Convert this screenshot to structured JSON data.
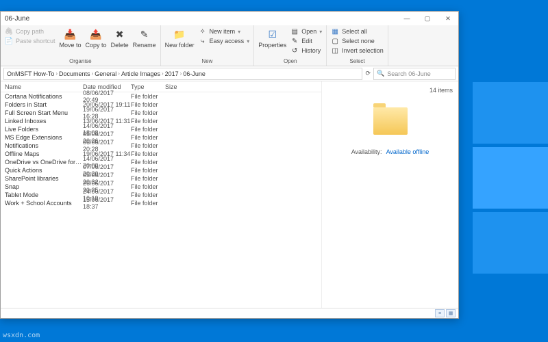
{
  "window": {
    "title": "06-June"
  },
  "ribbon": {
    "organise": {
      "copy_path": "Copy path",
      "paste_shortcut": "Paste shortcut",
      "move_to": "Move to",
      "copy_to": "Copy to",
      "delete": "Delete",
      "rename": "Rename",
      "group": "Organise"
    },
    "new": {
      "new_folder": "New folder",
      "new_item": "New item",
      "easy_access": "Easy access",
      "group": "New"
    },
    "open": {
      "properties": "Properties",
      "open": "Open",
      "edit": "Edit",
      "history": "History",
      "group": "Open"
    },
    "select": {
      "select_all": "Select all",
      "select_none": "Select none",
      "invert": "Invert selection",
      "group": "Select"
    }
  },
  "breadcrumbs": [
    "OnMSFT How-To",
    "Documents",
    "General",
    "Article Images",
    "2017",
    "06-June"
  ],
  "columns": {
    "name": "Name",
    "date": "Date modified",
    "type": "Type",
    "size": "Size"
  },
  "rows": [
    {
      "name": "Cortana Notifications",
      "date": "08/06/2017 20:49",
      "type": "File folder"
    },
    {
      "name": "Folders in Start",
      "date": "20/06/2017 19:11",
      "type": "File folder"
    },
    {
      "name": "Full Screen Start Menu",
      "date": "19/06/2017 16:28",
      "type": "File folder"
    },
    {
      "name": "Linked Inboxes",
      "date": "13/06/2017 11:31",
      "type": "File folder"
    },
    {
      "name": "Live Folders",
      "date": "14/06/2017 18:08",
      "type": "File folder"
    },
    {
      "name": "MS Edge Extensions",
      "date": "05/06/2017 20:26",
      "type": "File folder"
    },
    {
      "name": "Notifications",
      "date": "06/06/2017 20:28",
      "type": "File folder"
    },
    {
      "name": "Offline Maps",
      "date": "19/06/2017 11:34",
      "type": "File folder"
    },
    {
      "name": "OneDrive vs OneDrive for Business",
      "date": "14/06/2017 20:00",
      "type": "File folder"
    },
    {
      "name": "Quick Actions",
      "date": "07/06/2017 20:20",
      "type": "File folder"
    },
    {
      "name": "SharePoint libraries",
      "date": "05/06/2017 20:32",
      "type": "File folder"
    },
    {
      "name": "Snap",
      "date": "26/06/2017 20:25",
      "type": "File folder"
    },
    {
      "name": "Tablet Mode",
      "date": "24/06/2017 10:19",
      "type": "File folder"
    },
    {
      "name": "Work + School Accounts",
      "date": "15/06/2017 18:37",
      "type": "File folder"
    }
  ],
  "preview": {
    "count": "14 items",
    "availability_label": "Availability:",
    "availability_value": "Available offline"
  },
  "search": {
    "placeholder": "Search 06-June"
  },
  "watermark": "wsxdn.com"
}
